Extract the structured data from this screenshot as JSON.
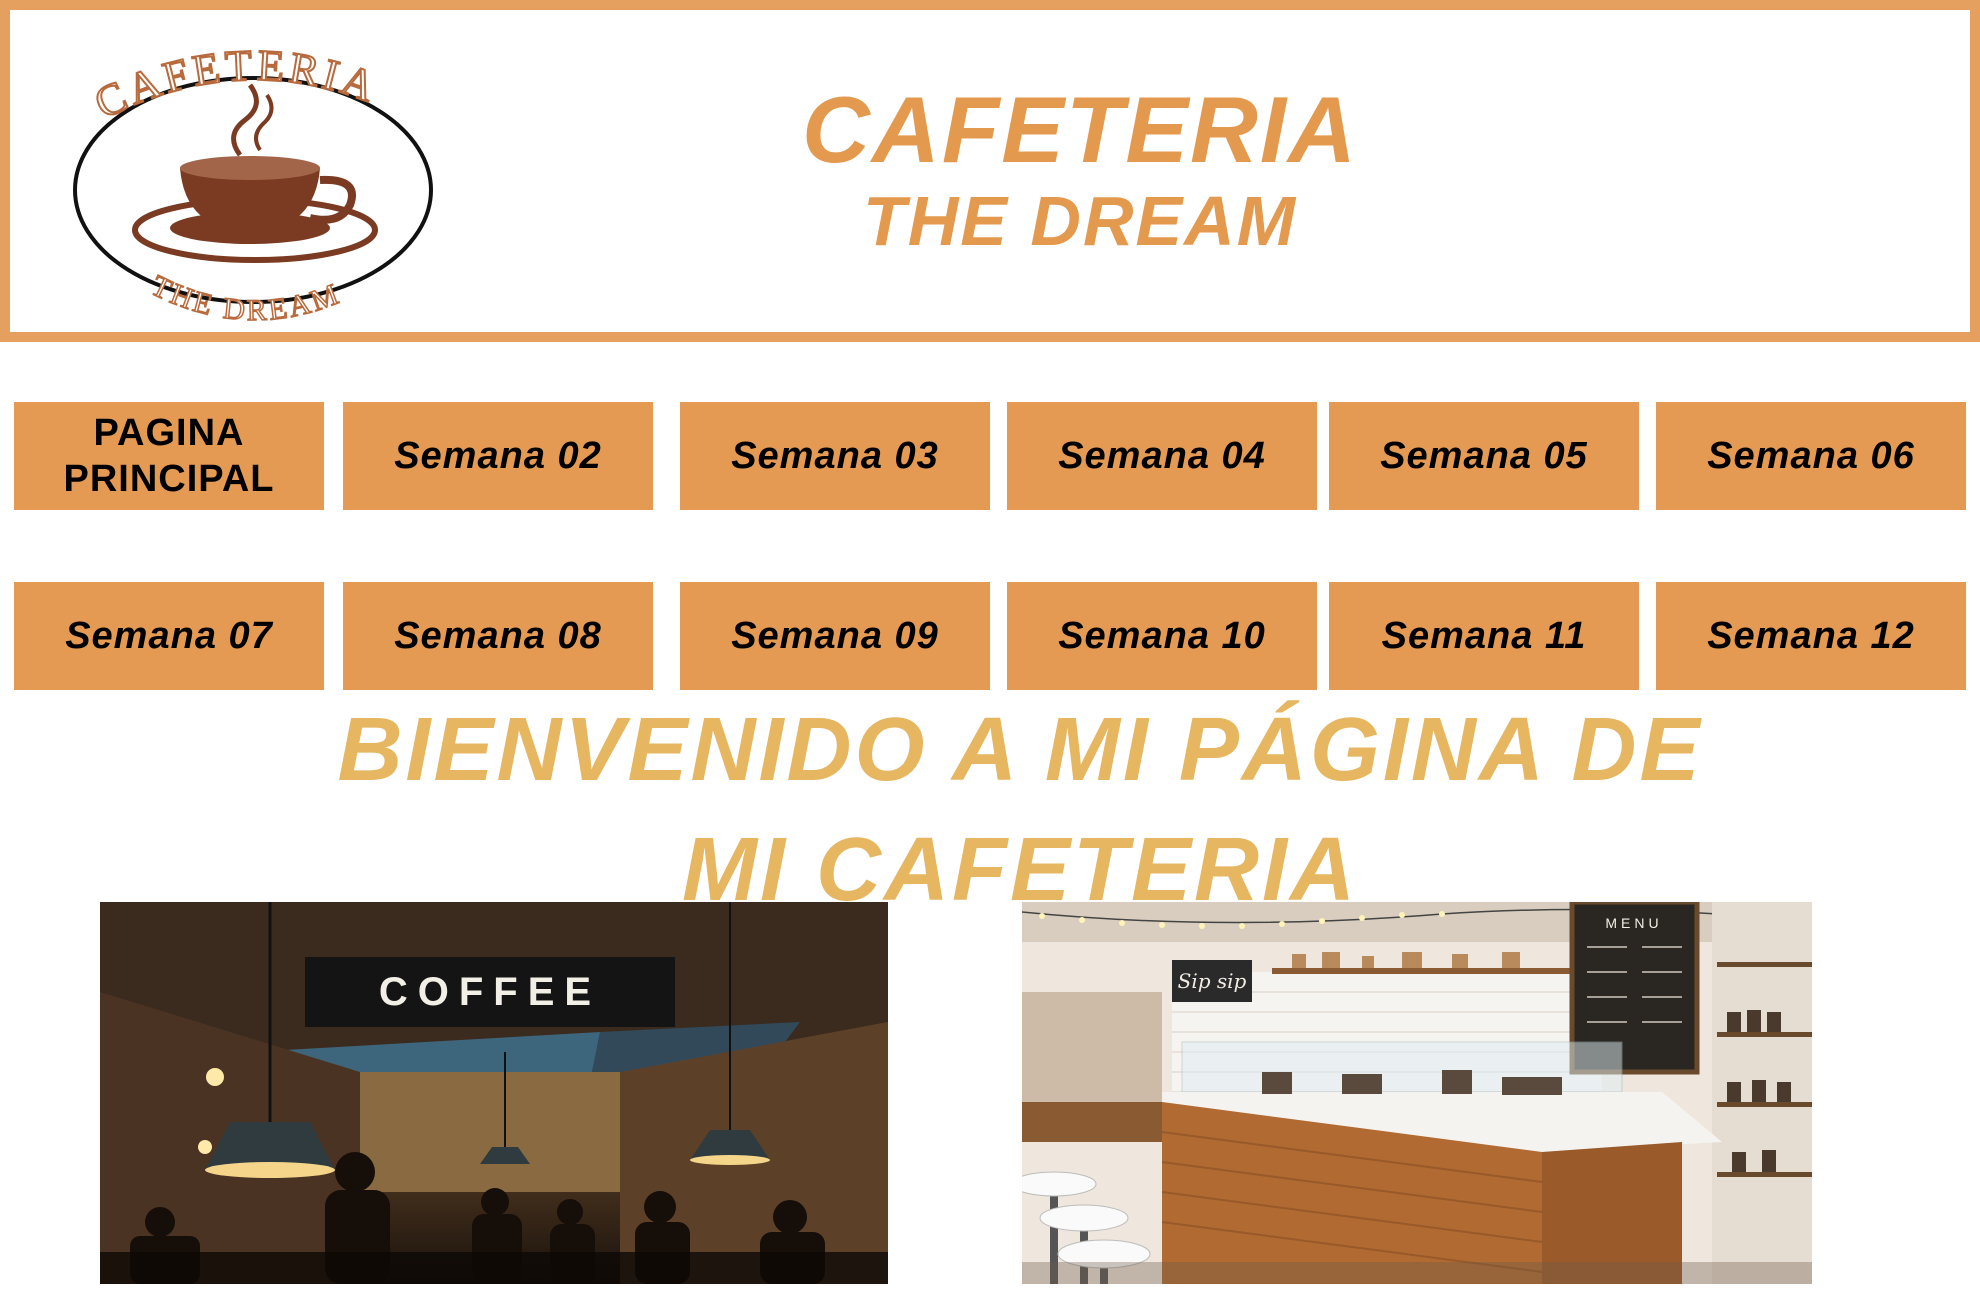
{
  "logo": {
    "top_text": "CAFETERIA",
    "bottom_text": "THE DREAM",
    "icon": "coffee-cup-icon"
  },
  "header": {
    "title": "CAFETERIA",
    "subtitle": "THE DREAM"
  },
  "nav": {
    "row1": [
      {
        "label": "PAGINA PRINCIPAL"
      },
      {
        "label": "Semana 02"
      },
      {
        "label": "Semana 03"
      },
      {
        "label": "Semana 04"
      },
      {
        "label": "Semana  05"
      },
      {
        "label": "Semana 06"
      }
    ],
    "row2": [
      {
        "label": "Semana 07"
      },
      {
        "label": "Semana 08"
      },
      {
        "label": "Semana 09"
      },
      {
        "label": "Semana 10"
      },
      {
        "label": "Semana 11"
      },
      {
        "label": "Semana 12"
      }
    ]
  },
  "welcome": {
    "line1": "BIENVENIDO A MI PÁGINA DE",
    "line2": "MI CAFETERIA"
  },
  "photos": {
    "left_sign": "COFFEE",
    "right_sign": "Sip sip",
    "right_menu": "MENU"
  },
  "colors": {
    "accent": "#e5a060",
    "button": "#e49a53",
    "title": "#e39a4e",
    "welcome": "#e6b660",
    "logo_brown": "#7a3b22"
  }
}
